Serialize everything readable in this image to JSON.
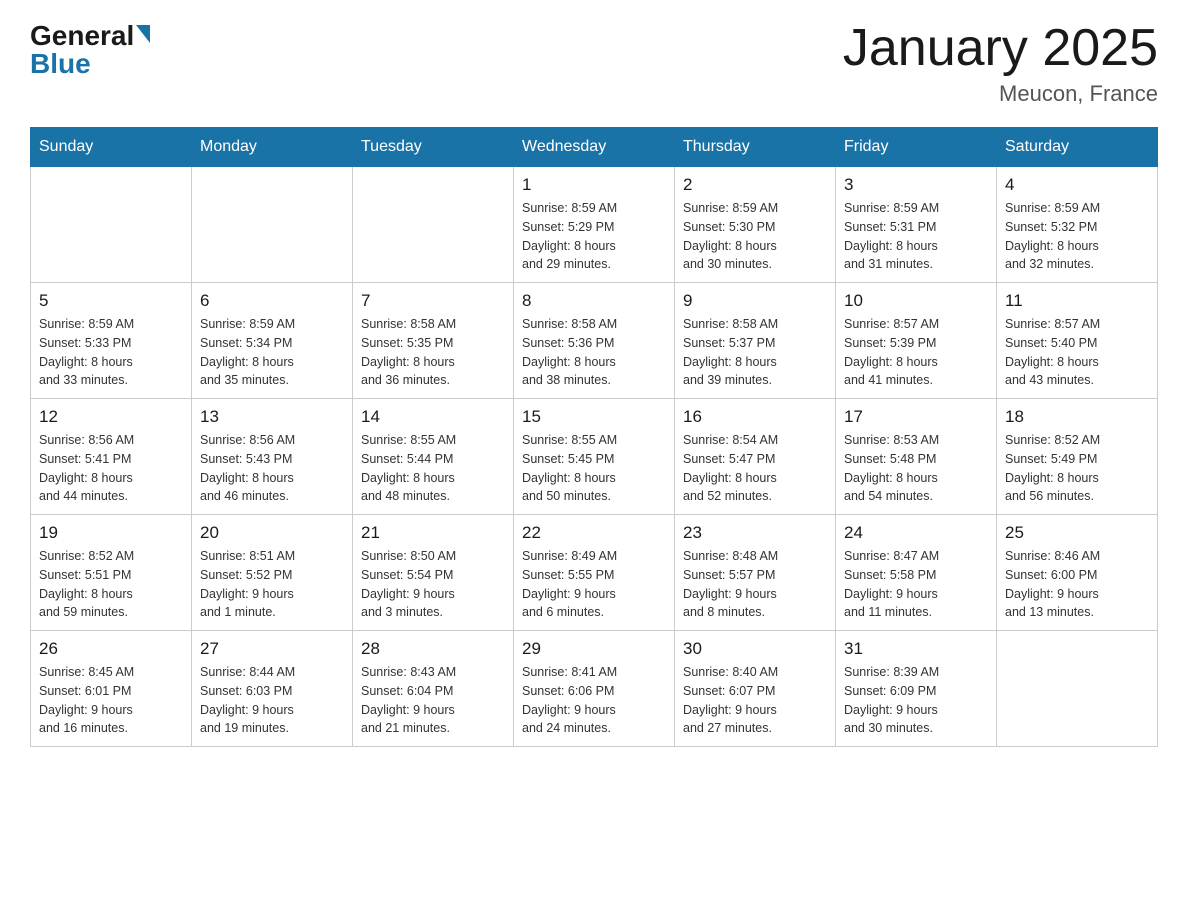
{
  "header": {
    "logo": {
      "general": "General",
      "blue": "Blue"
    },
    "title": "January 2025",
    "location": "Meucon, France"
  },
  "calendar": {
    "days_of_week": [
      "Sunday",
      "Monday",
      "Tuesday",
      "Wednesday",
      "Thursday",
      "Friday",
      "Saturday"
    ],
    "weeks": [
      [
        {
          "day": "",
          "info": ""
        },
        {
          "day": "",
          "info": ""
        },
        {
          "day": "",
          "info": ""
        },
        {
          "day": "1",
          "info": "Sunrise: 8:59 AM\nSunset: 5:29 PM\nDaylight: 8 hours\nand 29 minutes."
        },
        {
          "day": "2",
          "info": "Sunrise: 8:59 AM\nSunset: 5:30 PM\nDaylight: 8 hours\nand 30 minutes."
        },
        {
          "day": "3",
          "info": "Sunrise: 8:59 AM\nSunset: 5:31 PM\nDaylight: 8 hours\nand 31 minutes."
        },
        {
          "day": "4",
          "info": "Sunrise: 8:59 AM\nSunset: 5:32 PM\nDaylight: 8 hours\nand 32 minutes."
        }
      ],
      [
        {
          "day": "5",
          "info": "Sunrise: 8:59 AM\nSunset: 5:33 PM\nDaylight: 8 hours\nand 33 minutes."
        },
        {
          "day": "6",
          "info": "Sunrise: 8:59 AM\nSunset: 5:34 PM\nDaylight: 8 hours\nand 35 minutes."
        },
        {
          "day": "7",
          "info": "Sunrise: 8:58 AM\nSunset: 5:35 PM\nDaylight: 8 hours\nand 36 minutes."
        },
        {
          "day": "8",
          "info": "Sunrise: 8:58 AM\nSunset: 5:36 PM\nDaylight: 8 hours\nand 38 minutes."
        },
        {
          "day": "9",
          "info": "Sunrise: 8:58 AM\nSunset: 5:37 PM\nDaylight: 8 hours\nand 39 minutes."
        },
        {
          "day": "10",
          "info": "Sunrise: 8:57 AM\nSunset: 5:39 PM\nDaylight: 8 hours\nand 41 minutes."
        },
        {
          "day": "11",
          "info": "Sunrise: 8:57 AM\nSunset: 5:40 PM\nDaylight: 8 hours\nand 43 minutes."
        }
      ],
      [
        {
          "day": "12",
          "info": "Sunrise: 8:56 AM\nSunset: 5:41 PM\nDaylight: 8 hours\nand 44 minutes."
        },
        {
          "day": "13",
          "info": "Sunrise: 8:56 AM\nSunset: 5:43 PM\nDaylight: 8 hours\nand 46 minutes."
        },
        {
          "day": "14",
          "info": "Sunrise: 8:55 AM\nSunset: 5:44 PM\nDaylight: 8 hours\nand 48 minutes."
        },
        {
          "day": "15",
          "info": "Sunrise: 8:55 AM\nSunset: 5:45 PM\nDaylight: 8 hours\nand 50 minutes."
        },
        {
          "day": "16",
          "info": "Sunrise: 8:54 AM\nSunset: 5:47 PM\nDaylight: 8 hours\nand 52 minutes."
        },
        {
          "day": "17",
          "info": "Sunrise: 8:53 AM\nSunset: 5:48 PM\nDaylight: 8 hours\nand 54 minutes."
        },
        {
          "day": "18",
          "info": "Sunrise: 8:52 AM\nSunset: 5:49 PM\nDaylight: 8 hours\nand 56 minutes."
        }
      ],
      [
        {
          "day": "19",
          "info": "Sunrise: 8:52 AM\nSunset: 5:51 PM\nDaylight: 8 hours\nand 59 minutes."
        },
        {
          "day": "20",
          "info": "Sunrise: 8:51 AM\nSunset: 5:52 PM\nDaylight: 9 hours\nand 1 minute."
        },
        {
          "day": "21",
          "info": "Sunrise: 8:50 AM\nSunset: 5:54 PM\nDaylight: 9 hours\nand 3 minutes."
        },
        {
          "day": "22",
          "info": "Sunrise: 8:49 AM\nSunset: 5:55 PM\nDaylight: 9 hours\nand 6 minutes."
        },
        {
          "day": "23",
          "info": "Sunrise: 8:48 AM\nSunset: 5:57 PM\nDaylight: 9 hours\nand 8 minutes."
        },
        {
          "day": "24",
          "info": "Sunrise: 8:47 AM\nSunset: 5:58 PM\nDaylight: 9 hours\nand 11 minutes."
        },
        {
          "day": "25",
          "info": "Sunrise: 8:46 AM\nSunset: 6:00 PM\nDaylight: 9 hours\nand 13 minutes."
        }
      ],
      [
        {
          "day": "26",
          "info": "Sunrise: 8:45 AM\nSunset: 6:01 PM\nDaylight: 9 hours\nand 16 minutes."
        },
        {
          "day": "27",
          "info": "Sunrise: 8:44 AM\nSunset: 6:03 PM\nDaylight: 9 hours\nand 19 minutes."
        },
        {
          "day": "28",
          "info": "Sunrise: 8:43 AM\nSunset: 6:04 PM\nDaylight: 9 hours\nand 21 minutes."
        },
        {
          "day": "29",
          "info": "Sunrise: 8:41 AM\nSunset: 6:06 PM\nDaylight: 9 hours\nand 24 minutes."
        },
        {
          "day": "30",
          "info": "Sunrise: 8:40 AM\nSunset: 6:07 PM\nDaylight: 9 hours\nand 27 minutes."
        },
        {
          "day": "31",
          "info": "Sunrise: 8:39 AM\nSunset: 6:09 PM\nDaylight: 9 hours\nand 30 minutes."
        },
        {
          "day": "",
          "info": ""
        }
      ]
    ]
  }
}
